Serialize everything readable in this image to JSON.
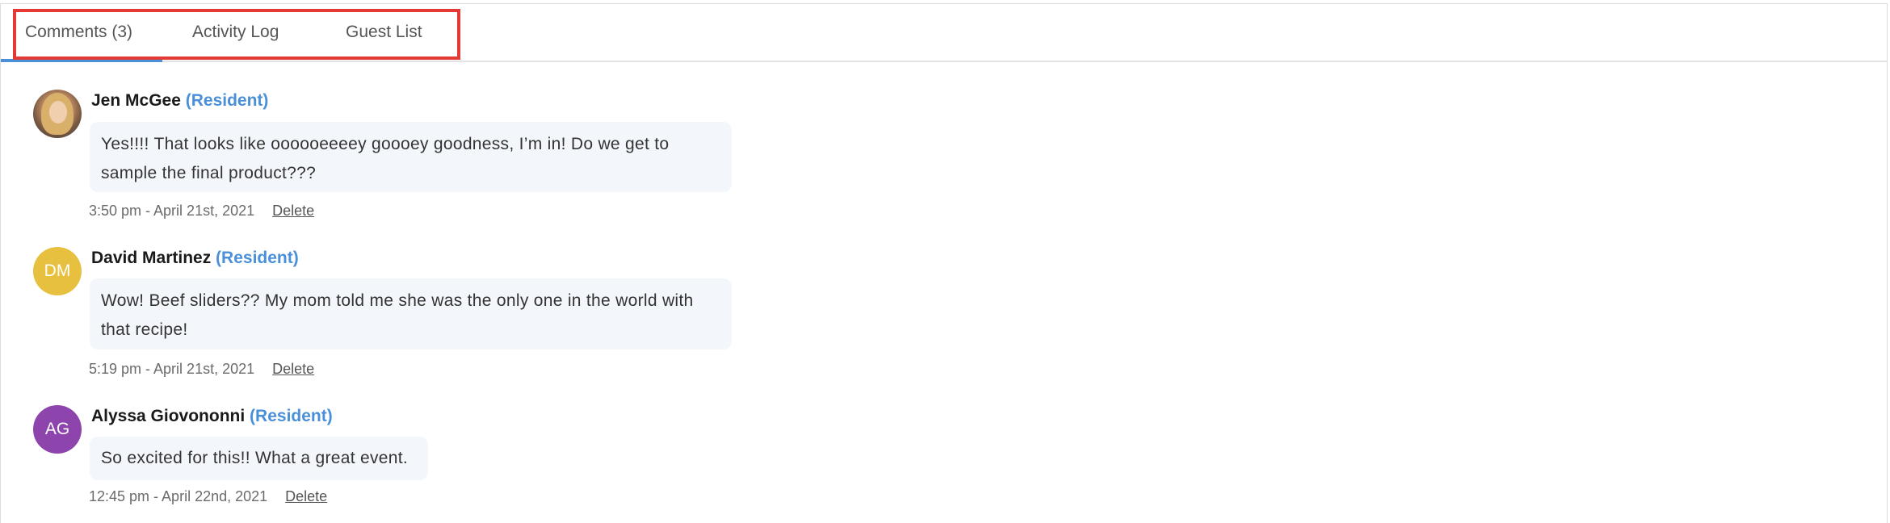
{
  "tabs": [
    {
      "label": "Comments (3)"
    },
    {
      "label": "Activity Log"
    },
    {
      "label": "Guest List"
    }
  ],
  "comments": [
    {
      "author": "Jen McGee",
      "role": "(Resident)",
      "avatar_type": "photo",
      "initials": "",
      "text": "Yes!!!! That looks like oooooeeeey goooey goodness, I’m in! Do we get to sample the final product???",
      "timestamp": "3:50 pm - April 21st, 2021",
      "delete_label": "Delete"
    },
    {
      "author": "David Martinez",
      "role": "(Resident)",
      "avatar_type": "initials",
      "initials": "DM",
      "avatar_color": "#e8c040",
      "text": "Wow! Beef sliders?? My mom told me she was the only one in the world with that recipe!",
      "timestamp": "5:19 pm - April 21st, 2021",
      "delete_label": "Delete"
    },
    {
      "author": "Alyssa Giovononni",
      "role": "(Resident)",
      "avatar_type": "initials",
      "initials": "AG",
      "avatar_color": "#8e44ad",
      "text": "So excited for this!! What a great event.",
      "timestamp": "12:45 pm - April 22nd, 2021",
      "delete_label": "Delete"
    }
  ],
  "colors": {
    "accent": "#4a90d9",
    "highlight": "#e53935",
    "bubble_bg": "#f3f7fb"
  }
}
